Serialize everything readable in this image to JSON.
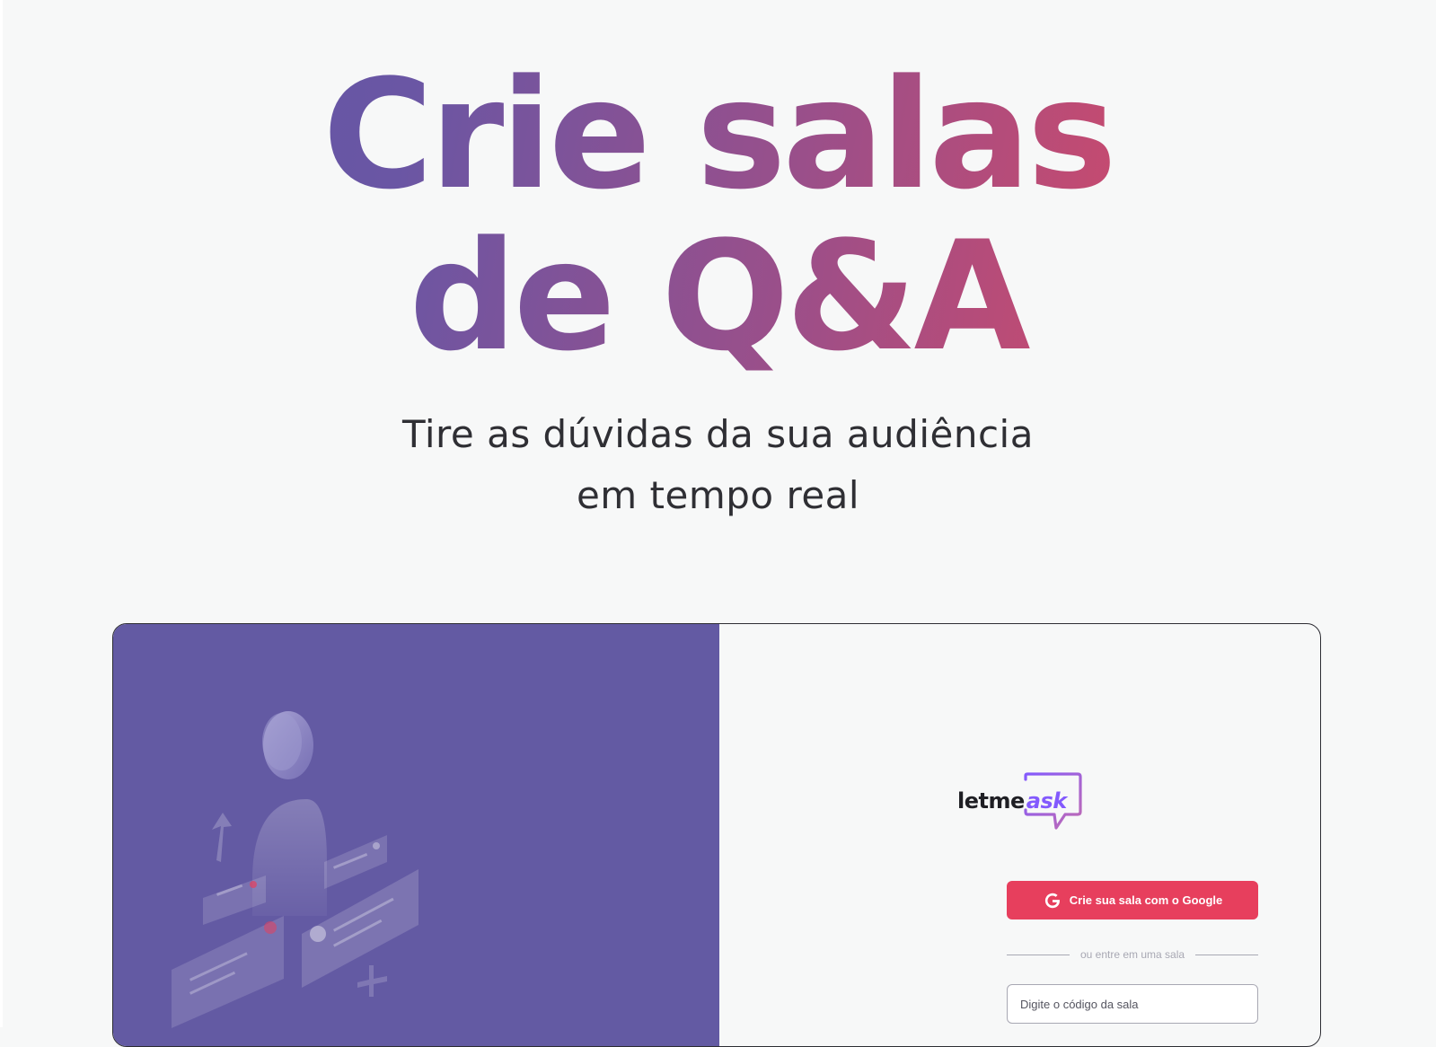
{
  "hero": {
    "title_line1": "Crie salas",
    "title_line2": "de Q&A",
    "subtitle_line1": "Tire as dúvidas da sua audiência",
    "subtitle_line2": "em tempo real"
  },
  "brand": {
    "logo_text_prefix": "letme",
    "logo_text_accent": "ask",
    "logo_icon": "speech-bubble-icon"
  },
  "auth": {
    "google_button_label": "Crie sua sala com o Google",
    "google_icon": "google-icon",
    "separator_label": "ou entre em uma sala",
    "room_code_placeholder": "Digite o código da sala"
  },
  "colors": {
    "brand_purple": "#635aa3",
    "google_button": "#e73f5d",
    "title_gradient_start": "#5d58a8",
    "title_gradient_end": "#dd4466",
    "logo_accent": "#835afd"
  }
}
